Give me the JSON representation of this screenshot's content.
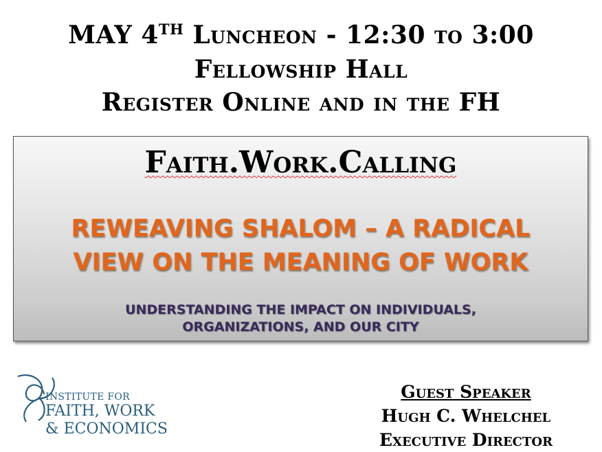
{
  "header": {
    "line1_prefix": "MAY 4",
    "line1_sup": "TH",
    "line1_suffix": " Luncheon - 12:30 to 3:00",
    "line2": "Fellowship Hall",
    "line3": "Register Online and in the FH"
  },
  "panel": {
    "title": "Faith.Work.Calling",
    "subtitle_line1": "REWEAVING SHALOM – A RADICAL",
    "subtitle_line2": "VIEW ON THE MEANING OF WORK",
    "tagline_line1": "UNDERSTANDING THE IMPACT ON INDIVIDUALS,",
    "tagline_line2": "ORGANIZATIONS, AND OUR CITY"
  },
  "logo": {
    "line1": "INSTITUTE FOR",
    "line2": "FAITH, WORK",
    "line3": "& ECONOMICS",
    "color": "#2a5f7e"
  },
  "speaker": {
    "heading": "Guest Speaker",
    "name": "Hugh C. Whelchel",
    "title": "Executive Director"
  },
  "colors": {
    "accent_orange": "#e0661e",
    "tagline_purple": "#3a2a5a"
  }
}
